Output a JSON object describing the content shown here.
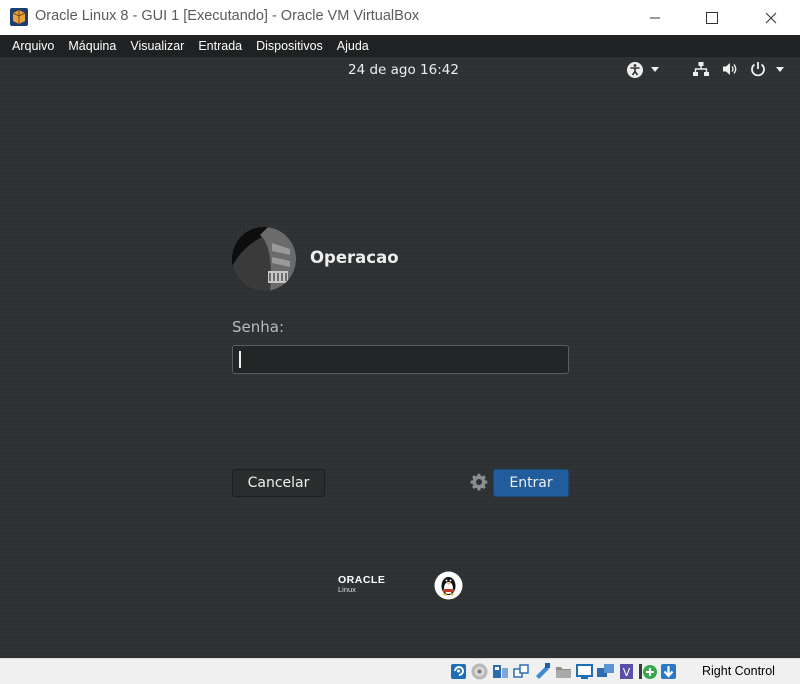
{
  "window": {
    "title": "Oracle Linux 8 - GUI 1 [Executando] - Oracle VM VirtualBox"
  },
  "menubar": {
    "items": [
      "Arquivo",
      "Máquina",
      "Visualizar",
      "Entrada",
      "Dispositivos",
      "Ajuda"
    ]
  },
  "guest": {
    "clock": "24 de ago  16:42",
    "login": {
      "username": "Operacao",
      "password_label": "Senha:",
      "password_value": "",
      "cancel_label": "Cancelar",
      "enter_label": "Entrar"
    },
    "logo": {
      "brand": "ORACLE",
      "sub": "Linux"
    }
  },
  "statusbar": {
    "host_key": "Right Control",
    "icons": [
      "hard-disk-icon",
      "optical-disk-icon",
      "audio-icon",
      "network-icon",
      "usb-icon",
      "shared-folders-icon",
      "display-icon",
      "video-capture-icon",
      "virtualization-icon",
      "mouse-integration-icon",
      "keyboard-capture-icon"
    ]
  },
  "colors": {
    "guest_bg": "#2e3133",
    "enter_button": "#215d9c",
    "menubar_bg": "#1f2122"
  }
}
